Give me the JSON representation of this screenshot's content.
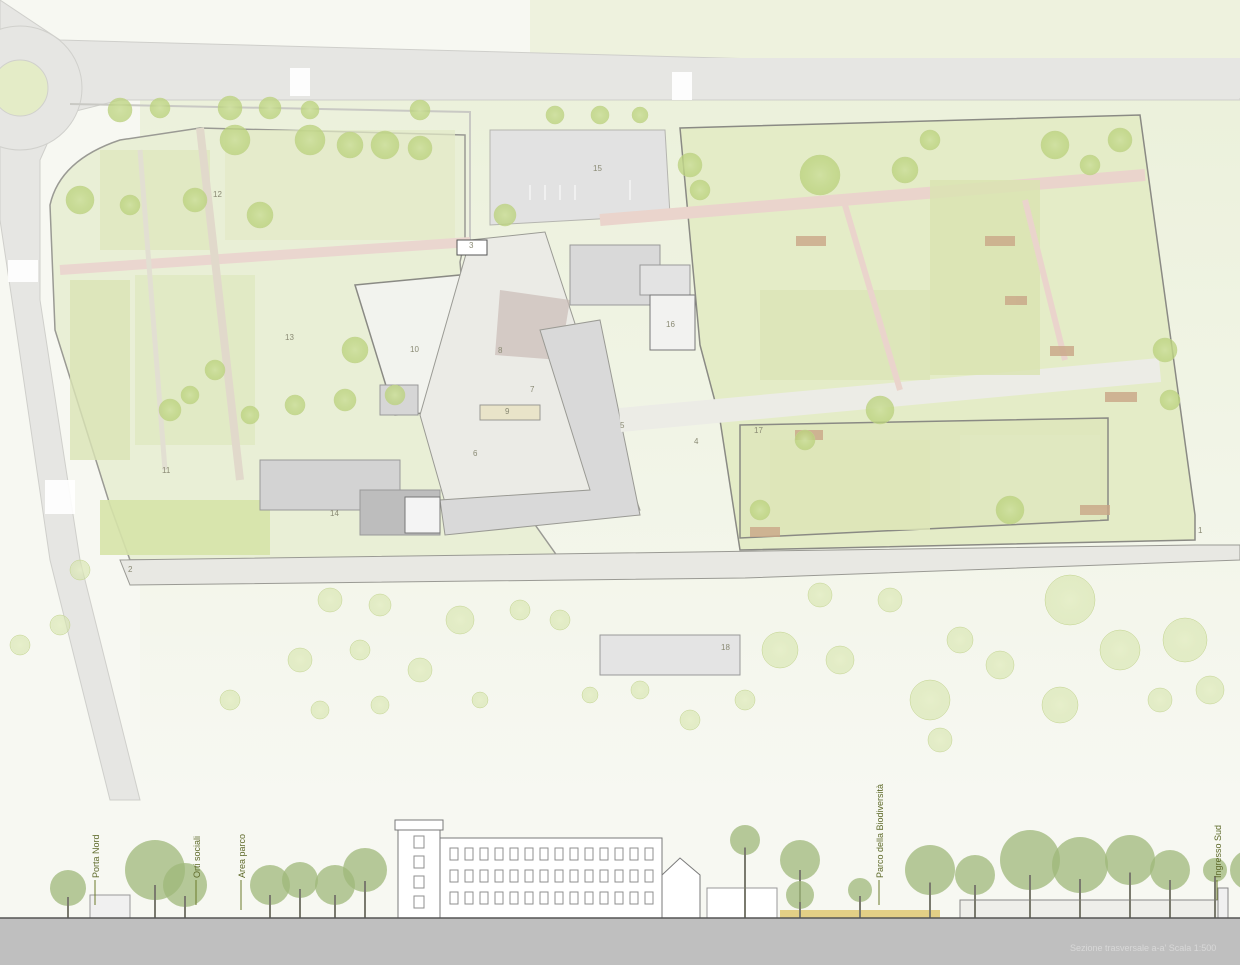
{
  "plan": {
    "zone_numbers": [
      "1",
      "2",
      "3",
      "4",
      "5",
      "6",
      "7",
      "8",
      "9",
      "10",
      "11",
      "12",
      "13",
      "14",
      "15",
      "16",
      "17",
      "18"
    ]
  },
  "section": {
    "labels": [
      "Porta Nord",
      "Orti sociali",
      "Area parco",
      "Parco della Biodiversità",
      "Ingresso Sud"
    ],
    "caption": "Sezione trasversale a-a'   Scala 1:500"
  },
  "colors": {
    "background": "#f7f8f2",
    "park_green": "#e9efd6",
    "tree_green": "#cfe0a0",
    "road": "#e6e6e3",
    "building": "#d6d6d6",
    "ground_strip": "#bfbfbf",
    "label_green": "#5e6a2a"
  }
}
